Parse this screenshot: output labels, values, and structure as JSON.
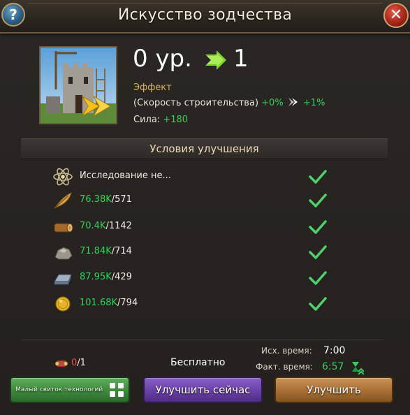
{
  "header": {
    "title": "Искусство зодчества",
    "help_label": "?",
    "close_label": "✕"
  },
  "level": {
    "current": "0 ур.",
    "next": "1"
  },
  "effect": {
    "label": "Эффект",
    "name": "(Скорость строительства)",
    "from": "+0%",
    "to": "+1%"
  },
  "power": {
    "label": "Сила:",
    "value": "+180"
  },
  "conditions": {
    "title": "Условия улучшения",
    "research_text": "Исследование не...",
    "resources": [
      {
        "icon": "feather-icon",
        "have": "76.38K",
        "need": "/571"
      },
      {
        "icon": "wood-log-icon",
        "have": "70.4K",
        "need": "/1142"
      },
      {
        "icon": "stone-icon",
        "have": "71.84K",
        "need": "/714"
      },
      {
        "icon": "iron-ingot-icon",
        "have": "87.95K",
        "need": "/429"
      },
      {
        "icon": "gold-coin-icon",
        "have": "101.68K",
        "need": "/794"
      }
    ]
  },
  "footer": {
    "scrolls_have": "0",
    "scrolls_need": "/1",
    "free_label": "Бесплатно",
    "orig_time_label": "Исх. время:",
    "orig_time_value": "7:00",
    "act_time_label": "Факт. время:",
    "act_time_value": "6:57"
  },
  "buttons": {
    "scroll_label": "Малый свиток технологий",
    "upgrade_now_label": "Улучшить сейчас",
    "upgrade_label": "Улучшить"
  },
  "colors": {
    "accent_green": "#2fd35b",
    "gold_text": "#d9b45a",
    "button_purple": "#6a3fa8",
    "button_brown": "#a86f35",
    "button_green": "#3c8a3a"
  }
}
